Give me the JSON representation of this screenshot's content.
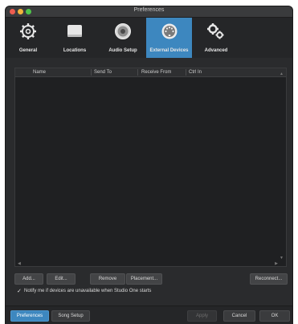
{
  "window": {
    "title": "Preferences"
  },
  "tabs": [
    {
      "label": "General",
      "icon": "gear-icon",
      "active": false
    },
    {
      "label": "Locations",
      "icon": "folder-icon",
      "active": false
    },
    {
      "label": "Audio Setup",
      "icon": "speaker-icon",
      "active": false
    },
    {
      "label": "External Devices",
      "icon": "midi-connector-icon",
      "active": true
    },
    {
      "label": "Advanced",
      "icon": "gears-icon",
      "active": false
    }
  ],
  "table": {
    "columns": [
      "Name",
      "Send To",
      "Receive From",
      "Ctrl In"
    ],
    "rows": []
  },
  "buttons": {
    "add": "Add...",
    "edit": "Edit...",
    "remove": "Remove",
    "placement": "Placement...",
    "reconnect": "Reconnect..."
  },
  "notify": {
    "checked": true,
    "label": "Notify me if devices are unavailable when Studio One starts"
  },
  "footer": {
    "preferences": "Preferences",
    "song_setup": "Song Setup",
    "apply": "Apply",
    "cancel": "Cancel",
    "ok": "OK"
  },
  "colors": {
    "accent": "#3d87bf",
    "background": "#2a2b2d",
    "toolbar": "#252628"
  }
}
